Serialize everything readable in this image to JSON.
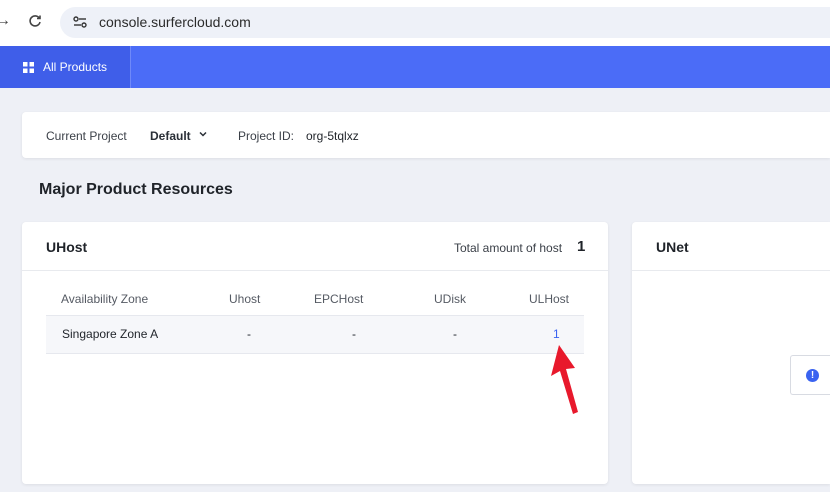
{
  "browser": {
    "url": "console.surfercloud.com"
  },
  "topnav": {
    "all_products_label": "All Products"
  },
  "project_bar": {
    "current_label": "Current Project",
    "current_value": "Default",
    "project_id_label": "Project ID:",
    "project_id_value": "org-5tqlxz"
  },
  "section_title": "Major Product Resources",
  "uhost_card": {
    "title": "UHost",
    "total_label": "Total amount of host",
    "total_value": "1",
    "columns": [
      "Availability Zone",
      "Uhost",
      "EPCHost",
      "UDisk",
      "ULHost"
    ],
    "rows": [
      [
        "Singapore Zone A",
        "-",
        "-",
        "-",
        "1"
      ]
    ]
  },
  "unet_card": {
    "title": "UNet",
    "info_icon": "info-icon"
  },
  "colors": {
    "nav_blue": "#4b6cf7",
    "link_blue": "#3a63f0",
    "pointer_red": "#e8192c"
  }
}
